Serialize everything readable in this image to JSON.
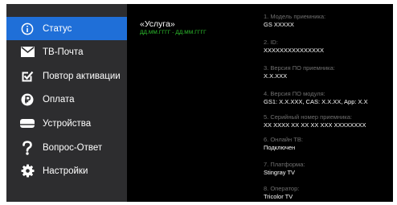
{
  "sidebar": {
    "items": [
      {
        "label": "Статус",
        "icon": "info-icon",
        "active": true
      },
      {
        "label": "ТВ-Почта",
        "icon": "mail-icon",
        "active": false
      },
      {
        "label": "Повтор активации",
        "icon": "check-icon",
        "active": false
      },
      {
        "label": "Оплата",
        "icon": "payment-icon",
        "active": false
      },
      {
        "label": "Устройства",
        "icon": "devices-icon",
        "active": false
      },
      {
        "label": "Вопрос-Ответ",
        "icon": "question-icon",
        "active": false
      },
      {
        "label": "Настройки",
        "icon": "gear-icon",
        "active": false
      }
    ]
  },
  "service": {
    "name": "«Услуга»",
    "dates": "ДД.ММ.ГГГГ - ДД.ММ.ГГГГ"
  },
  "info": [
    {
      "label": "1. Модель приемника:",
      "value": "GS XXXXX"
    },
    {
      "label": "2. ID:",
      "value": "XXXXXXXXXXXXXXX"
    },
    {
      "label": "3. Версия ПО приемника:",
      "value": "X.X.XXX"
    },
    {
      "label": "4. Версия ПО модуля:",
      "value": "GS1: X.X.XXX, CAS: X.X.XX, App: X.X"
    },
    {
      "label": "5. Серийный номер приемника:",
      "value": "XX XXXX XX XX XX XXX XXXXXXXX"
    },
    {
      "label": "6. Онлайн ТВ:",
      "value": "Подключен"
    },
    {
      "label": "7. Платформа:",
      "value": "Stingray TV"
    },
    {
      "label": "8. Оператор:",
      "value": "Tricolor TV"
    }
  ],
  "colors": {
    "active_item": "#1f6fd8",
    "sidebar_bg": "#2d2d2f",
    "dates": "#2fc52f"
  }
}
